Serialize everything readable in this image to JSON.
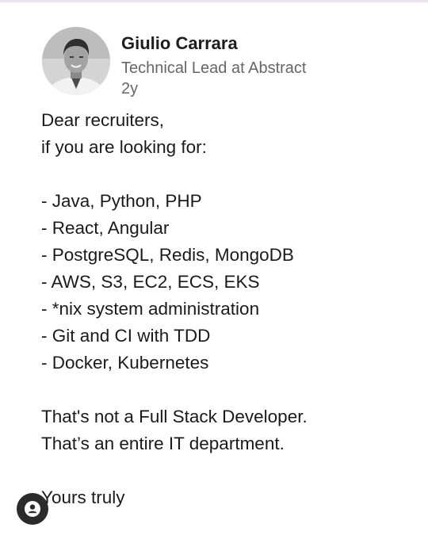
{
  "author": {
    "name": "Giulio Carrara",
    "headline": "Technical Lead at Abstract",
    "time_ago": "2y"
  },
  "post": {
    "greeting": [
      "Dear recruiters,",
      "if you are looking for:"
    ],
    "skills": [
      "- Java, Python, PHP",
      "- React, Angular",
      "- PostgreSQL, Redis, MongoDB",
      "- AWS, S3, EC2, ECS, EKS",
      "- *nix system administration",
      "- Git and CI with TDD",
      "- Docker, Kubernetes"
    ],
    "conclusion": [
      "That's not a Full Stack Developer.",
      "That’s an entire IT department."
    ],
    "signoff": "Yours truly"
  },
  "icons": {
    "profile_button": "user-icon"
  },
  "colors": {
    "name": "#1d1d1d",
    "meta": "#666666",
    "body": "#1a1a1a",
    "profile_button_bg": "#2b2b2b"
  }
}
